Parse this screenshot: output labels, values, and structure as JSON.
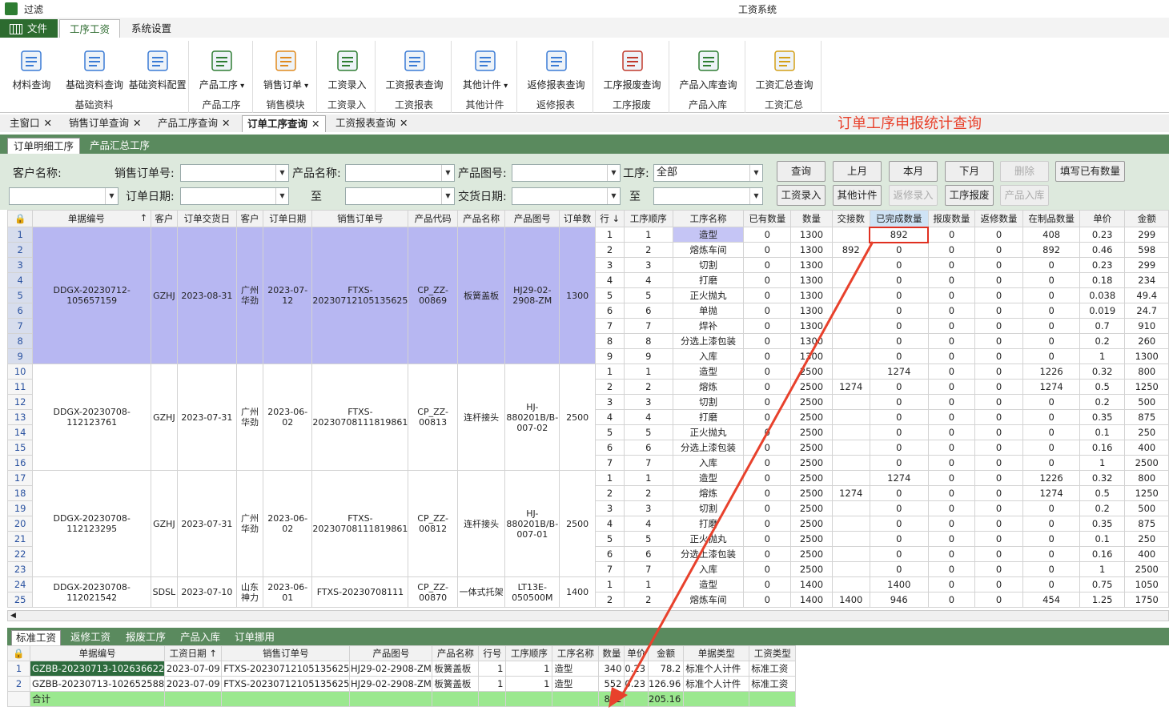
{
  "window": {
    "name": "过滤",
    "system_title": "工资系统"
  },
  "menu": {
    "file": "文件",
    "wage": "工序工资",
    "settings": "系统设置"
  },
  "ribbon": {
    "groups": [
      {
        "label": "基础资料",
        "buttons": [
          {
            "label": "材料查询",
            "icon": "magnifier-document-icon"
          },
          {
            "label": "基础资料查询",
            "icon": "search-icon"
          },
          {
            "label": "基础资料配置",
            "icon": "network-config-icon"
          }
        ]
      },
      {
        "label": "产品工序",
        "buttons": [
          {
            "label": "产品工序",
            "icon": "org-chart-icon",
            "dropdown": true
          }
        ]
      },
      {
        "label": "销售模块",
        "buttons": [
          {
            "label": "销售订单",
            "icon": "shopping-cart-icon",
            "dropdown": true
          }
        ]
      },
      {
        "label": "工资录入",
        "buttons": [
          {
            "label": "工资录入",
            "icon": "list-icon"
          }
        ]
      },
      {
        "label": "工资报表",
        "buttons": [
          {
            "label": "工资报表查询",
            "icon": "report-icon"
          }
        ]
      },
      {
        "label": "其他计件",
        "buttons": [
          {
            "label": "其他计件",
            "icon": "grid-sheet-icon",
            "dropdown": true
          }
        ]
      },
      {
        "label": "返修报表",
        "buttons": [
          {
            "label": "返修报表查询",
            "icon": "window-report-icon"
          }
        ]
      },
      {
        "label": "工序报废",
        "buttons": [
          {
            "label": "工序报废查询",
            "icon": "scrap-window-icon"
          }
        ]
      },
      {
        "label": "产品入库",
        "buttons": [
          {
            "label": "产品入库查询",
            "icon": "basket-icon"
          }
        ]
      },
      {
        "label": "工资汇总",
        "buttons": [
          {
            "label": "工资汇总查询",
            "icon": "wave-chart-icon"
          }
        ]
      }
    ]
  },
  "tabs": [
    {
      "label": "主窗口"
    },
    {
      "label": "销售订单查询"
    },
    {
      "label": "产品工序查询"
    },
    {
      "label": "订单工序查询",
      "active": true
    },
    {
      "label": "工资报表查询"
    }
  ],
  "annotation": "订单工序申报统计查询",
  "subtabs": [
    "订单明细工序",
    "产品汇总工序"
  ],
  "filter": {
    "customer_label": "客户名称:",
    "sales_order_label": "销售订单号:",
    "product_name_label": "产品名称:",
    "drawing_label": "产品图号:",
    "process_label": "工序:",
    "process_value": "全部",
    "order_date_label": "订单日期:",
    "to_label": "至",
    "delivery_label": "交货日期:",
    "buttons": {
      "query": "查询",
      "prev_month": "上月",
      "this_month": "本月",
      "next_month": "下月",
      "delete": "删除",
      "fill": "填写已有数量",
      "wage_entry": "工资录入",
      "other_piece": "其他计件",
      "repair_entry": "返修录入",
      "process_scrap": "工序报废",
      "product_in": "产品入库"
    }
  },
  "grid": {
    "headers": {
      "doc_no": "单据编号",
      "sort_up": "↑",
      "cust": "客户",
      "deliv": "订单交货日",
      "cust2": "客户",
      "odate": "订单日期",
      "so": "销售订单号",
      "pcode": "产品代码",
      "pname": "产品名称",
      "pdraw": "产品图号",
      "oqty": "订单数",
      "line": "行",
      "sort_down": "↓",
      "seq": "工序顺序",
      "proc": "工序名称",
      "have": "已有数量",
      "qty": "数量",
      "hand": "交接数",
      "done": "已完成数量",
      "scrap": "报废数量",
      "repair": "返修数量",
      "wip": "在制品数量",
      "price": "单价",
      "amount": "金额"
    },
    "orders": [
      {
        "doc_no": "DDGX-20230712-105657159",
        "cust": "GZHJ",
        "deliv": "2023-08-31",
        "cust2": "广州华劲",
        "odate": "2023-07-12",
        "so": "FTXS-20230712105135625",
        "pcode": "CP_ZZ-00869",
        "pname": "板簧盖板",
        "pdraw": "HJ29-02-2908-ZM",
        "oqty": "1300",
        "rows": 9
      },
      {
        "doc_no": "DDGX-20230708-112123761",
        "cust": "GZHJ",
        "deliv": "2023-07-31",
        "cust2": "广州华劲",
        "odate": "2023-06-02",
        "so": "FTXS-20230708111819861",
        "pcode": "CP_ZZ-00813",
        "pname": "连杆接头",
        "pdraw": "HJ-880201B/B-007-02",
        "oqty": "2500",
        "rows": 7
      },
      {
        "doc_no": "DDGX-20230708-112123295",
        "cust": "GZHJ",
        "deliv": "2023-07-31",
        "cust2": "广州华劲",
        "odate": "2023-06-02",
        "so": "FTXS-20230708111819861",
        "pcode": "CP_ZZ-00812",
        "pname": "连杆接头",
        "pdraw": "HJ-880201B/B-007-01",
        "oqty": "2500",
        "rows": 7
      },
      {
        "doc_no": "DDGX-20230708-112021542",
        "cust": "SDSL",
        "deliv": "2023-07-10",
        "cust2": "山东神力",
        "odate": "2023-06-01",
        "so": "FTXS-20230708111",
        "pcode": "CP_ZZ-00870",
        "pname": "一体式托架",
        "pdraw": "LT13E-050500M",
        "oqty": "1400",
        "rows": 2
      }
    ],
    "rows": [
      [
        "1",
        "1",
        "造型",
        "0",
        "1300",
        "",
        "892",
        "0",
        "0",
        "408",
        "0.23",
        "299"
      ],
      [
        "2",
        "2",
        "熔炼车间",
        "0",
        "1300",
        "892",
        "0",
        "0",
        "0",
        "892",
        "0.46",
        "598"
      ],
      [
        "3",
        "3",
        "切割",
        "0",
        "1300",
        "",
        "0",
        "0",
        "0",
        "0",
        "0.23",
        "299"
      ],
      [
        "4",
        "4",
        "打磨",
        "0",
        "1300",
        "",
        "0",
        "0",
        "0",
        "0",
        "0.18",
        "234"
      ],
      [
        "5",
        "5",
        "正火抛丸",
        "0",
        "1300",
        "",
        "0",
        "0",
        "0",
        "0",
        "0.038",
        "49.4"
      ],
      [
        "6",
        "6",
        "单抛",
        "0",
        "1300",
        "",
        "0",
        "0",
        "0",
        "0",
        "0.019",
        "24.7"
      ],
      [
        "7",
        "7",
        "焊补",
        "0",
        "1300",
        "",
        "0",
        "0",
        "0",
        "0",
        "0.7",
        "910"
      ],
      [
        "8",
        "8",
        "分选上漆包装",
        "0",
        "1300",
        "",
        "0",
        "0",
        "0",
        "0",
        "0.2",
        "260"
      ],
      [
        "9",
        "9",
        "入库",
        "0",
        "1300",
        "",
        "0",
        "0",
        "0",
        "0",
        "1",
        "1300"
      ],
      [
        "1",
        "1",
        "造型",
        "0",
        "2500",
        "",
        "1274",
        "0",
        "0",
        "1226",
        "0.32",
        "800"
      ],
      [
        "2",
        "2",
        "熔炼",
        "0",
        "2500",
        "1274",
        "0",
        "0",
        "0",
        "1274",
        "0.5",
        "1250"
      ],
      [
        "3",
        "3",
        "切割",
        "0",
        "2500",
        "",
        "0",
        "0",
        "0",
        "0",
        "0.2",
        "500"
      ],
      [
        "4",
        "4",
        "打磨",
        "0",
        "2500",
        "",
        "0",
        "0",
        "0",
        "0",
        "0.35",
        "875"
      ],
      [
        "5",
        "5",
        "正火抛丸",
        "0",
        "2500",
        "",
        "0",
        "0",
        "0",
        "0",
        "0.1",
        "250"
      ],
      [
        "6",
        "6",
        "分选上漆包装",
        "0",
        "2500",
        "",
        "0",
        "0",
        "0",
        "0",
        "0.16",
        "400"
      ],
      [
        "7",
        "7",
        "入库",
        "0",
        "2500",
        "",
        "0",
        "0",
        "0",
        "0",
        "1",
        "2500"
      ],
      [
        "1",
        "1",
        "造型",
        "0",
        "2500",
        "",
        "1274",
        "0",
        "0",
        "1226",
        "0.32",
        "800"
      ],
      [
        "2",
        "2",
        "熔炼",
        "0",
        "2500",
        "1274",
        "0",
        "0",
        "0",
        "1274",
        "0.5",
        "1250"
      ],
      [
        "3",
        "3",
        "切割",
        "0",
        "2500",
        "",
        "0",
        "0",
        "0",
        "0",
        "0.2",
        "500"
      ],
      [
        "4",
        "4",
        "打磨",
        "0",
        "2500",
        "",
        "0",
        "0",
        "0",
        "0",
        "0.35",
        "875"
      ],
      [
        "5",
        "5",
        "正火抛丸",
        "0",
        "2500",
        "",
        "0",
        "0",
        "0",
        "0",
        "0.1",
        "250"
      ],
      [
        "6",
        "6",
        "分选上漆包装",
        "0",
        "2500",
        "",
        "0",
        "0",
        "0",
        "0",
        "0.16",
        "400"
      ],
      [
        "7",
        "7",
        "入库",
        "0",
        "2500",
        "",
        "0",
        "0",
        "0",
        "0",
        "1",
        "2500"
      ],
      [
        "1",
        "1",
        "造型",
        "0",
        "1400",
        "",
        "1400",
        "0",
        "0",
        "0",
        "0.75",
        "1050"
      ],
      [
        "2",
        "2",
        "熔炼车间",
        "0",
        "1400",
        "1400",
        "946",
        "0",
        "0",
        "454",
        "1.25",
        "1750"
      ]
    ]
  },
  "bottom": {
    "tabs": [
      "标准工资",
      "返修工资",
      "报废工序",
      "产品入库",
      "订单挪用"
    ],
    "headers": [
      "单据编号",
      "工资日期",
      "↑",
      "销售订单号",
      "产品图号",
      "产品名称",
      "行号",
      "工序顺序",
      "工序名称",
      "数量",
      "单价",
      "金额",
      "单据类型",
      "工资类型"
    ],
    "rows": [
      [
        "1",
        "GZBB-20230713-102636622",
        "2023-07-09",
        "FTXS-20230712105135625",
        "HJ29-02-2908-ZM",
        "板簧盖板",
        "1",
        "1",
        "造型",
        "340",
        "0.23",
        "78.2",
        "标准个人计件",
        "标准工资"
      ],
      [
        "2",
        "GZBB-20230713-102652588",
        "2023-07-09",
        "FTXS-20230712105135625",
        "HJ29-02-2908-ZM",
        "板簧盖板",
        "1",
        "1",
        "造型",
        "552",
        "0.23",
        "126.96",
        "标准个人计件",
        "标准工资"
      ]
    ],
    "total": {
      "label": "合计",
      "qty": "892",
      "amount": "205.16"
    }
  },
  "colors": {
    "accent": "#2d6b2f",
    "annotation_red": "#e8412c",
    "selected_row": "#b7b7f2",
    "total_row": "#9be88f"
  }
}
